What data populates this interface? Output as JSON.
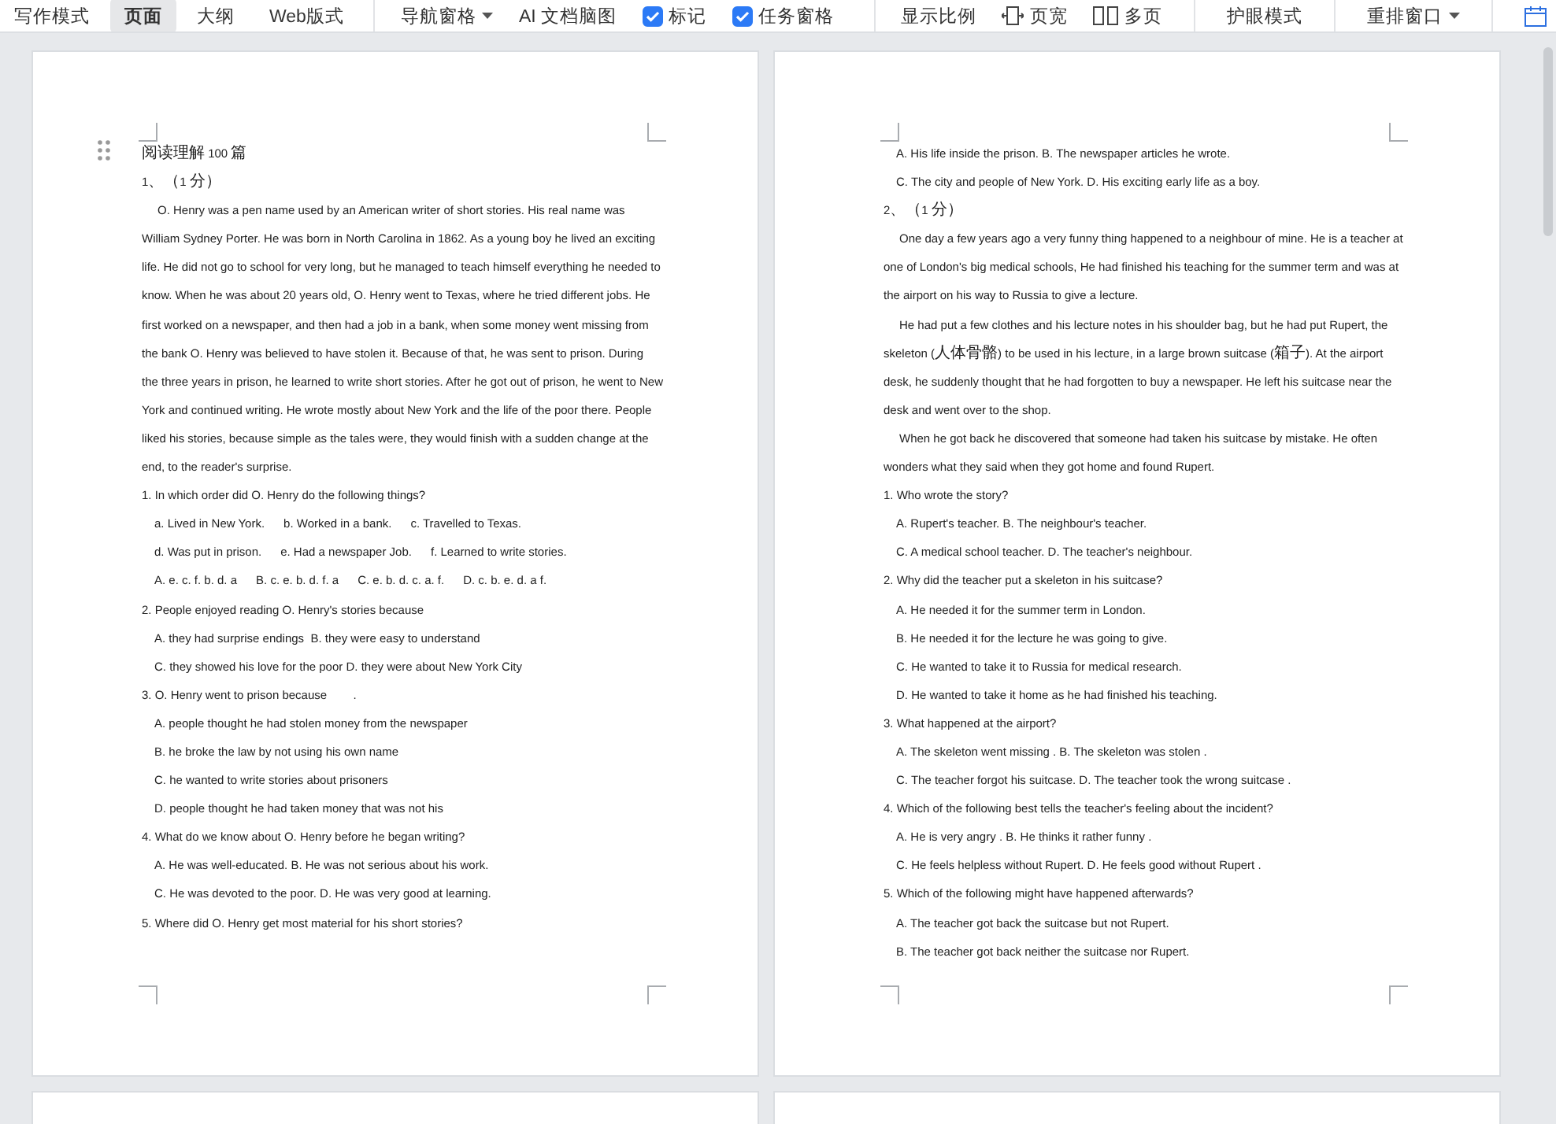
{
  "toolbar": {
    "views": [
      {
        "label": "写作模式",
        "selected": false
      },
      {
        "label": "页面",
        "selected": true
      },
      {
        "label": "大纲",
        "selected": false
      },
      {
        "label": "Web版式",
        "selected": false
      }
    ],
    "tools": [
      {
        "kind": "dropdown",
        "label": "导航窗格"
      },
      {
        "kind": "text",
        "label": "AI 文档脑图"
      },
      {
        "kind": "checkbox",
        "label": "标记",
        "checked": true
      },
      {
        "kind": "checkbox",
        "label": "任务窗格",
        "checked": true
      }
    ],
    "right_tools": [
      {
        "kind": "text",
        "label": "显示比例"
      },
      {
        "kind": "page-width",
        "label": "页宽"
      },
      {
        "kind": "multi-page",
        "label": "多页"
      },
      {
        "kind": "divider"
      },
      {
        "kind": "text",
        "label": "护眼模式"
      },
      {
        "kind": "divider"
      },
      {
        "kind": "dropdown",
        "label": "重排窗口"
      },
      {
        "kind": "divider"
      },
      {
        "kind": "calendar"
      }
    ]
  },
  "pages": [
    {
      "handle": true,
      "lines": [
        {
          "kind": "heading",
          "text": "阅读理解 100 篇"
        },
        {
          "kind": "section",
          "text": "1、（1 分）"
        },
        {
          "kind": "para",
          "text": "O. Henry was a pen name used by an American writer of short stories. His real name was William Sydney Porter. He was born in North Carolina in 1862. As a young boy he lived an exciting life. He did not go to school for very long, but he managed to teach himself everything he needed to know. When he was about 20 years old, O. Henry went to Texas, where he tried different jobs. He first worked on a newspaper, and then had a job in a bank, when some money went missing from the bank O. Henry was believed to have stolen it. Because of that, he was sent to prison. During the three years in prison, he learned to write short stories. After he got out of prison, he went to New York and continued writing. He wrote mostly about New York and the life of the poor there. People liked his stories, because simple as the tales were, they would finish with a sudden change at the end, to the reader's surprise."
        },
        {
          "kind": "question",
          "text": "1. In which order did O. Henry do the following things?"
        },
        {
          "kind": "choices",
          "parts": [
            "a. Lived in New York.",
            "b. Worked in a bank.",
            "c. Travelled to Texas."
          ]
        },
        {
          "kind": "choices",
          "parts": [
            "d. Was put in prison.",
            "e. Had a newspaper Job.",
            "f. Learned to write stories."
          ]
        },
        {
          "kind": "choices",
          "parts": [
            "A. e. c. f. b. d. a",
            "B. c. e. b. d. f. a",
            "C. e. b. d. c. a. f.",
            "D. c. b. e. d. a f."
          ]
        },
        {
          "kind": "question",
          "text": "2. People enjoyed reading O. Henry's stories because"
        },
        {
          "kind": "option",
          "text": "A. they had surprise endings  B. they were easy to understand"
        },
        {
          "kind": "option",
          "text": "C. they showed his love for the poor D. they were about New York City"
        },
        {
          "kind": "question",
          "text": "3. O. Henry went to prison because        ."
        },
        {
          "kind": "option",
          "text": "A. people thought he had stolen money from the newspaper"
        },
        {
          "kind": "option",
          "text": "B. he broke the law by not using his own name"
        },
        {
          "kind": "option",
          "text": "C. he wanted to write stories about prisoners"
        },
        {
          "kind": "option",
          "text": "D. people thought he had taken money that was not his"
        },
        {
          "kind": "question",
          "text": "4. What do we know about O. Henry before he began writing?"
        },
        {
          "kind": "option",
          "text": "A. He was well-educated. B. He was not serious about his work."
        },
        {
          "kind": "option",
          "text": "C. He was devoted to the poor. D. He was very good at learning."
        },
        {
          "kind": "question",
          "text": "5. Where did O. Henry get most material for his short stories?"
        }
      ]
    },
    {
      "handle": false,
      "lines": [
        {
          "kind": "option",
          "text": "A. His life inside the prison. B. The newspaper articles he wrote."
        },
        {
          "kind": "option",
          "text": "C. The city and people of New York. D. His exciting early life as a boy."
        },
        {
          "kind": "section",
          "text": "2、（1 分）"
        },
        {
          "kind": "para",
          "text": "One day a few years ago a very funny thing happened to a neighbour of mine. He is a teacher at one of London's big medical schools, He had finished his teaching for the summer term and was at the airport on his way to Russia to give a lecture."
        },
        {
          "kind": "para",
          "text": "He had put a few clothes and his lecture notes in his shoulder bag, but he had put Rupert, the skeleton (人体骨骼) to be used in his lecture, in a large brown suitcase (箱子). At the airport desk, he suddenly thought that he had forgotten to buy a newspaper. He left his suitcase near the desk and went over to the shop."
        },
        {
          "kind": "para",
          "text": "When he got back he discovered that someone had taken his suitcase by mistake. He often wonders what they said when they got home and found Rupert."
        },
        {
          "kind": "question",
          "text": "1. Who wrote the story?"
        },
        {
          "kind": "option",
          "text": "A. Rupert's teacher. B. The neighbour's teacher."
        },
        {
          "kind": "option",
          "text": "C. A medical school teacher. D. The teacher's neighbour."
        },
        {
          "kind": "question",
          "text": "2. Why did the teacher put a skeleton in his suitcase?"
        },
        {
          "kind": "option",
          "text": "A. He needed it for the summer term in London."
        },
        {
          "kind": "option",
          "text": "B. He needed it for the lecture he was going to give."
        },
        {
          "kind": "option",
          "text": "C. He wanted to take it to Russia for medical research."
        },
        {
          "kind": "option",
          "text": "D. He wanted to take it home as he had finished his teaching."
        },
        {
          "kind": "question",
          "text": "3. What happened at the airport?"
        },
        {
          "kind": "option",
          "text": "A. The skeleton went missing . B. The skeleton was stolen ."
        },
        {
          "kind": "option",
          "text": "C. The teacher forgot his suitcase. D. The teacher took the wrong suitcase ."
        },
        {
          "kind": "question",
          "text": "4. Which of the following best tells the teacher's feeling about the incident?"
        },
        {
          "kind": "option",
          "text": "A. He is very angry . B. He thinks it rather funny ."
        },
        {
          "kind": "option",
          "text": "C. He feels helpless without Rupert. D. He feels good without Rupert ."
        },
        {
          "kind": "question",
          "text": "5. Which of the following might have happened afterwards?"
        },
        {
          "kind": "option",
          "text": "A. The teacher got back the suitcase but not Rupert."
        },
        {
          "kind": "option",
          "text": "B. The teacher got back neither the suitcase nor Rupert."
        }
      ]
    }
  ]
}
